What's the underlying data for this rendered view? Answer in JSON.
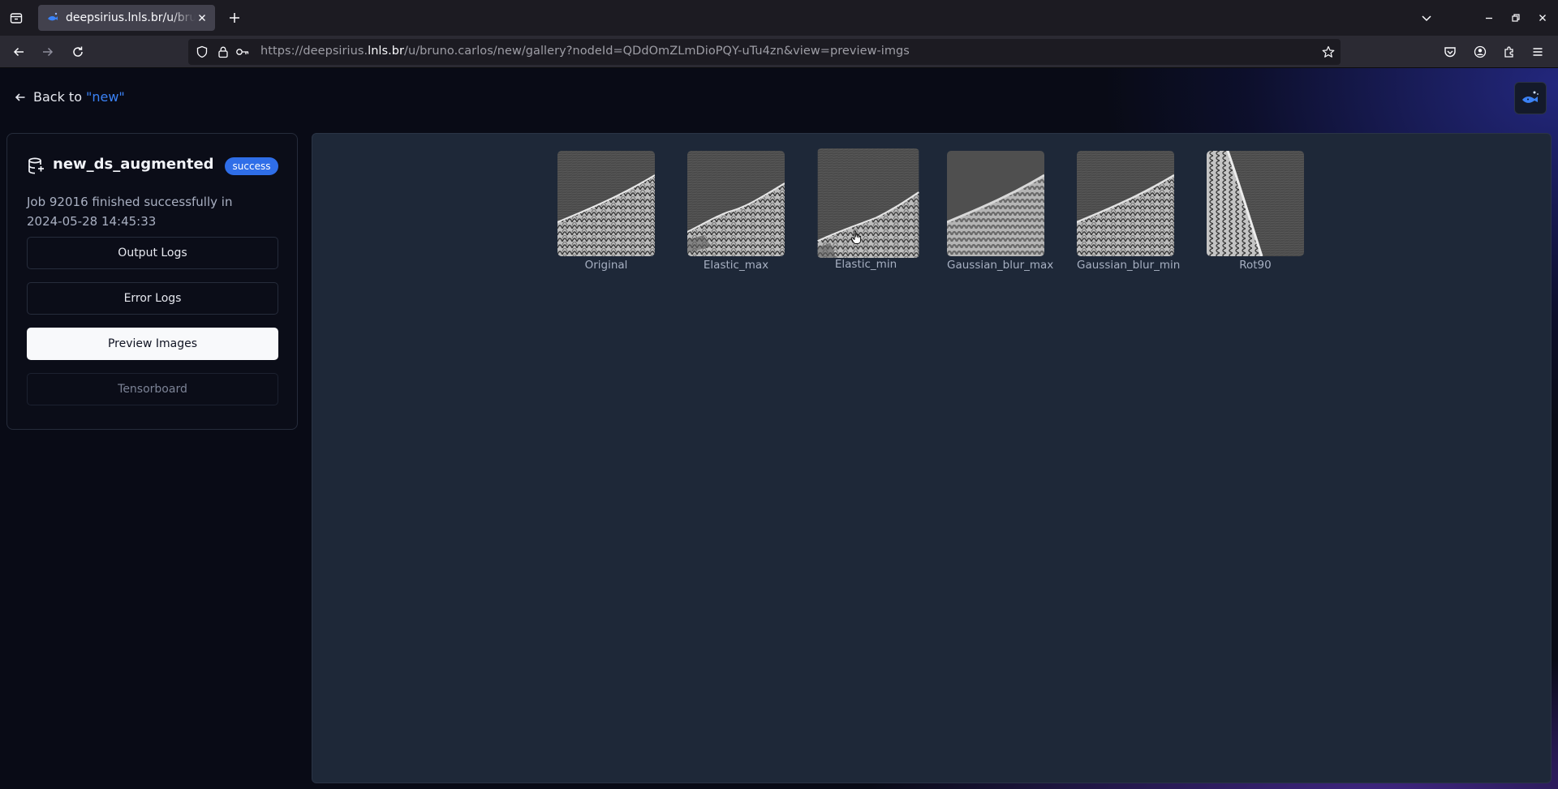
{
  "browser": {
    "tab": {
      "title": "deepsirius.lnls.br/u/bruno.carlos/new/gallery"
    },
    "url": {
      "scheme": "https://",
      "subdomain": "deepsirius.",
      "host": "lnls.br",
      "path": "/u/bruno.carlos/new/gallery?nodeId=QDdOmZLmDioPQY-uTu4zn&view=preview-imgs"
    }
  },
  "header": {
    "back_label": "Back to",
    "back_target": "\"new\""
  },
  "sidebar": {
    "dataset_name": "new_ds_augmented",
    "status_badge": "success",
    "job_line1": "Job 92016 finished successfully in",
    "job_line2": "2024-05-28 14:45:33",
    "buttons": {
      "output_logs": "Output Logs",
      "error_logs": "Error Logs",
      "preview_images": "Preview Images",
      "tensorboard": "Tensorboard"
    }
  },
  "gallery": {
    "images": [
      {
        "label": "Original"
      },
      {
        "label": "Elastic_max"
      },
      {
        "label": "Elastic_min"
      },
      {
        "label": "Gaussian_blur_max"
      },
      {
        "label": "Gaussian_blur_min"
      },
      {
        "label": "Rot90"
      }
    ]
  },
  "colors": {
    "accent": "#3b82f6",
    "badge": "#2f6ee8",
    "panel": "#1e2838"
  }
}
